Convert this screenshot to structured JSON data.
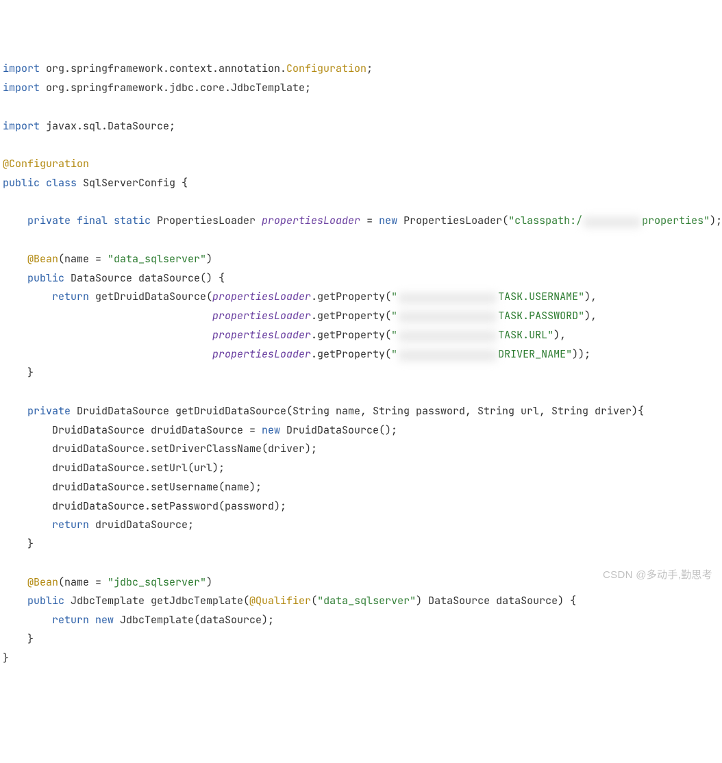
{
  "code": {
    "imports": [
      {
        "kw": "import",
        "pkg": "org.springframework.context.annotation.",
        "cls": "Configuration",
        "semi": ";"
      },
      {
        "kw": "import",
        "pkg": "org.springframework.jdbc.core.JdbcTemplate;",
        "cls": "",
        "semi": ""
      },
      {
        "kw": "import",
        "pkg": "javax.sql.DataSource;",
        "cls": "",
        "semi": ""
      }
    ],
    "annotation_cfg": "@Configuration",
    "class_decl": {
      "mods": "public class ",
      "name": "SqlServerConfig {"
    },
    "field": {
      "mods": "private final static ",
      "type": "PropertiesLoader ",
      "name": "propertiesLoader",
      "assign": " = ",
      "newkw": "new ",
      "ctor": "PropertiesLoader(",
      "str_open": "\"classpath:/",
      "str_close": "properties\"",
      "end": ");"
    },
    "bean1": {
      "at": "@Bean",
      "args_open": "(name = ",
      "args_str": "\"data_sqlserver\"",
      "args_close": ")"
    },
    "ds_method": {
      "sig1": "public ",
      "sig2": "DataSource dataSource() {"
    },
    "ds_return": {
      "ret": "return ",
      "call": "getDruidDataSource(",
      "pl": "propertiesLoader",
      "gp": ".getProperty(",
      "s1": "\"",
      "t1": "TASK.USERNAME\"",
      "c1": "),",
      "t2": "TASK.PASSWORD\"",
      "c2": "),",
      "t3": "TASK.URL\"",
      "c3": "),",
      "t4": "DRIVER_NAME\"",
      "c4": "));"
    },
    "brace_close": "}",
    "druid_method": {
      "sig1": "private ",
      "sig2": "DruidDataSource getDruidDataSource(String name, String password, String url, String driver){"
    },
    "druid_body": {
      "l1a": "DruidDataSource druidDataSource = ",
      "l1_new": "new ",
      "l1b": "DruidDataSource();",
      "l2": "druidDataSource.setDriverClassName(driver);",
      "l3": "druidDataSource.setUrl(url);",
      "l4": "druidDataSource.setUsername(name);",
      "l5": "druidDataSource.setPassword(password);",
      "l6_ret": "return ",
      "l6_b": "druidDataSource;"
    },
    "bean2": {
      "at": "@Bean",
      "args_open": "(name = ",
      "args_str": "\"jdbc_sqlserver\"",
      "args_close": ")"
    },
    "jdbc_method": {
      "sig1": "public ",
      "sig2": "JdbcTemplate getJdbcTemplate(",
      "q_at": "@Qualifier",
      "q_open": "(",
      "q_str": "\"data_sqlserver\"",
      "q_close": ") DataSource dataSource) {"
    },
    "jdbc_body": {
      "ret": "return ",
      "newkw": "new ",
      "rest": "JdbcTemplate(dataSource);"
    }
  },
  "watermark": "CSDN @多动手,勤思考"
}
